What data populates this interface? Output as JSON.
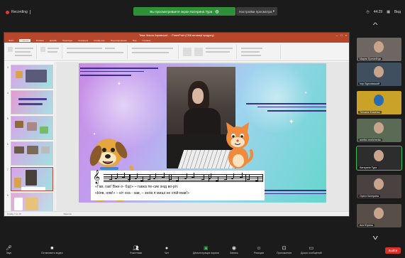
{
  "topbar": {
    "recording": "Recording",
    "share_notice": "Вы просматриваете экран Катерина Тура",
    "view_options": "Настройки просмотра",
    "clock": "44:29",
    "view_mode": "Вид"
  },
  "ppt": {
    "window_title": "Тема: Масла Харківської... - PowerPoint (Сбій активації продукту)",
    "tabs": [
      "Файл",
      "Главная",
      "Вставка",
      "Дизайн",
      "Переходы",
      "Анимация",
      "Слайд-шоу",
      "Рецензирование",
      "Вид",
      "Справка"
    ],
    "active_tab": "Главная",
    "notes_placeholder": "Заметки к слайду",
    "status_left": "Слайд 7 из 10",
    "status_mid": "Заметки"
  },
  "slide": {
    "lyric_1": "«Гав, гав! Вже о- бід!» – гавка пе-сик знiд во-рiт.",
    "lyric_2": "«Няв, няв!» – кiт ска - зав, – знов я мишi не спiй-мав!»"
  },
  "participants": [
    {
      "name": "Мария Еремейчук"
    },
    {
      "name": "Ігор Бурковський"
    },
    {
      "name": "Тетьяна Фоменко"
    },
    {
      "name": "anetta omelchenko"
    },
    {
      "name": "Катерина Тура"
    },
    {
      "name": "Орест Катерина"
    },
    {
      "name": "Ася Юрина"
    }
  ],
  "toolbar": {
    "mic": "Звук",
    "video": "Остановить видео",
    "participants": "Участники",
    "participants_count": "11",
    "chat": "Чат",
    "share": "Демонстрация экрана",
    "record": "Запись",
    "reactions": "Реакции",
    "apps": "Приложения",
    "whiteboards": "Доски сообщений",
    "end": "Выйти"
  },
  "colors": {
    "share_green": "#2f8f3a",
    "ppt_red": "#b7472a",
    "end_red": "#d7322c",
    "deco_navy": "#3b2f86"
  }
}
